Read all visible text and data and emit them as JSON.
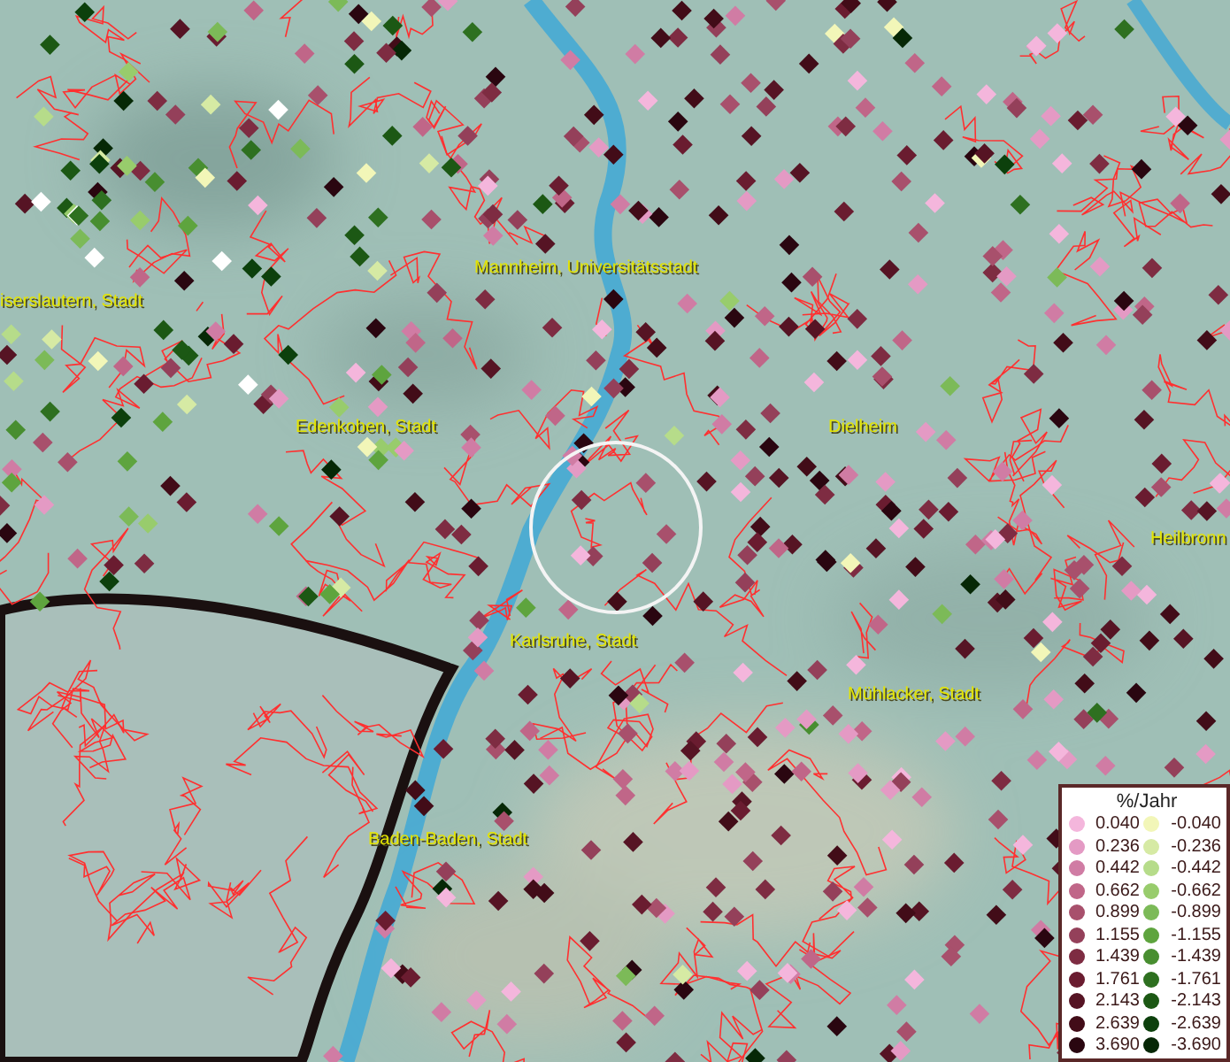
{
  "map": {
    "labels": [
      {
        "text": "Mannheim, Universitätsstadt"
      },
      {
        "text": "iserslautern, Stadt"
      },
      {
        "text": "Edenkoben, Stadt"
      },
      {
        "text": "Dielheim"
      },
      {
        "text": "Heilbronn"
      },
      {
        "text": "Karlsruhe, Stadt"
      },
      {
        "text": "Mühlacker, Stadt"
      },
      {
        "text": "Baden-Baden, Stadt"
      }
    ]
  },
  "legend": {
    "title": "%/Jahr",
    "positive": [
      {
        "label": "0.040",
        "color": "#f4b6dc"
      },
      {
        "label": "0.236",
        "color": "#e49ac4"
      },
      {
        "label": "0.442",
        "color": "#d07ca4"
      },
      {
        "label": "0.662",
        "color": "#c06688"
      },
      {
        "label": "0.899",
        "color": "#a8506c"
      },
      {
        "label": "1.155",
        "color": "#94405a"
      },
      {
        "label": "1.439",
        "color": "#7e2c42"
      },
      {
        "label": "1.761",
        "color": "#6a1c30"
      },
      {
        "label": "2.143",
        "color": "#561424"
      },
      {
        "label": "2.639",
        "color": "#420c18"
      },
      {
        "label": "3.690",
        "color": "#2a0610"
      }
    ],
    "negative": [
      {
        "label": "-0.040",
        "color": "#f2f6b8"
      },
      {
        "label": "-0.236",
        "color": "#d6eaa4"
      },
      {
        "label": "-0.442",
        "color": "#b6dc8a"
      },
      {
        "label": "-0.662",
        "color": "#98cc6c"
      },
      {
        "label": "-0.899",
        "color": "#7cba58"
      },
      {
        "label": "-1.155",
        "color": "#5ea43e"
      },
      {
        "label": "-1.439",
        "color": "#488e30"
      },
      {
        "label": "-1.761",
        "color": "#2e7020"
      },
      {
        "label": "-2.143",
        "color": "#1c5814"
      },
      {
        "label": "-2.639",
        "color": "#0c400c"
      },
      {
        "label": "-3.690",
        "color": "#062806"
      }
    ]
  }
}
